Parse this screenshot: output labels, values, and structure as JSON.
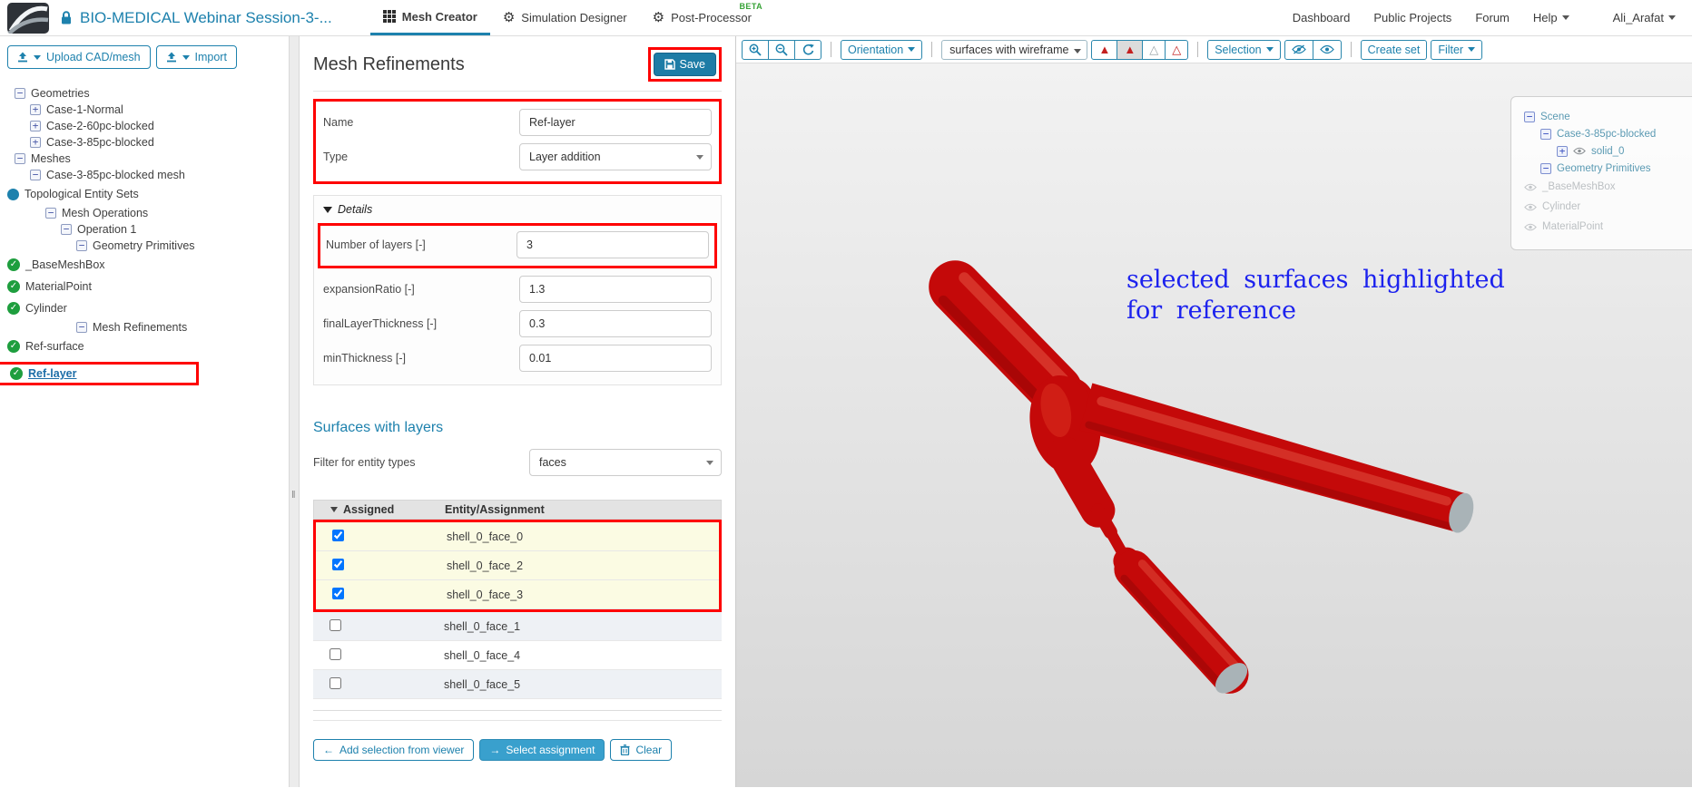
{
  "colors": {
    "accent": "#1d81ad",
    "annotation_box": "#fe0000",
    "annotation_text": "#1c22ee",
    "model_red": "#c40909",
    "model_cap_gray": "#a9b3b7",
    "beta_green": "#37a337",
    "row_selected_yellow": "#fbfbe3"
  },
  "icons": {
    "collapse": "−",
    "expand": "+",
    "check": "✓",
    "left_arrow": "←",
    "right_arrow": "→",
    "grip": "‖"
  },
  "navbar": {
    "project_title": "BIO-MEDICAL Webinar Session-3-...",
    "tabs": [
      {
        "label": "Mesh Creator",
        "active": true
      },
      {
        "label": "Simulation Designer",
        "active": false
      },
      {
        "label": "Post-Processor",
        "active": false,
        "badge": "BETA"
      }
    ],
    "links": [
      {
        "label": "Dashboard"
      },
      {
        "label": "Public Projects"
      },
      {
        "label": "Forum"
      },
      {
        "label": "Help"
      }
    ],
    "user": "Ali_Arafat"
  },
  "sidebar": {
    "upload_button": "Upload CAD/mesh",
    "import_button": "Import",
    "tree": [
      {
        "label": "Geometries",
        "depth": 0,
        "icon": "collapse"
      },
      {
        "label": "Case-1-Normal",
        "depth": 1,
        "icon": "expand"
      },
      {
        "label": "Case-2-60pc-blocked",
        "depth": 1,
        "icon": "expand"
      },
      {
        "label": "Case-3-85pc-blocked",
        "depth": 1,
        "icon": "expand"
      },
      {
        "label": "Meshes",
        "depth": 0,
        "icon": "collapse"
      },
      {
        "label": "Case-3-85pc-blocked mesh",
        "depth": 1,
        "icon": "collapse"
      },
      {
        "label": "Topological Entity Sets",
        "depth": 2,
        "icon": "dot"
      },
      {
        "label": "Mesh Operations",
        "depth": 2,
        "icon": "collapse"
      },
      {
        "label": "Operation 1",
        "depth": 3,
        "icon": "collapse"
      },
      {
        "label": "Geometry Primitives",
        "depth": 4,
        "icon": "collapse"
      },
      {
        "label": "_BaseMeshBox",
        "depth": 5,
        "icon": "check"
      },
      {
        "label": "MaterialPoint",
        "depth": 5,
        "icon": "check"
      },
      {
        "label": "Cylinder",
        "depth": 5,
        "icon": "check"
      },
      {
        "label": "Mesh Refinements",
        "depth": 4,
        "icon": "collapse"
      },
      {
        "label": "Ref-surface",
        "depth": 5,
        "icon": "check"
      },
      {
        "label": "Ref-layer",
        "depth": 5,
        "icon": "check",
        "selected": true
      }
    ]
  },
  "panel": {
    "title": "Mesh Refinements",
    "save_label": "Save",
    "fields": {
      "name_label": "Name",
      "name_value": "Ref-layer",
      "type_label": "Type",
      "type_value": "Layer addition"
    },
    "details": {
      "header": "Details",
      "rows": [
        {
          "label": "Number of layers [-]",
          "value": "3",
          "highlighted": true
        },
        {
          "label": "expansionRatio [-]",
          "value": "1.3",
          "highlighted": false
        },
        {
          "label": "finalLayerThickness [-]",
          "value": "0.3",
          "highlighted": false
        },
        {
          "label": "minThickness [-]",
          "value": "0.01",
          "highlighted": false
        }
      ]
    },
    "surfaces": {
      "heading": "Surfaces with layers",
      "filter_label": "Filter for entity types",
      "filter_value": "faces",
      "table_headers": {
        "assigned": "Assigned",
        "entity": "Entity/Assignment"
      },
      "rows": [
        {
          "entity": "shell_0_face_0",
          "checked": true,
          "highlighted": true
        },
        {
          "entity": "shell_0_face_2",
          "checked": true,
          "highlighted": true
        },
        {
          "entity": "shell_0_face_3",
          "checked": true,
          "highlighted": true
        },
        {
          "entity": "shell_0_face_1",
          "checked": false,
          "highlighted": false
        },
        {
          "entity": "shell_0_face_4",
          "checked": false,
          "highlighted": false
        },
        {
          "entity": "shell_0_face_5",
          "checked": false,
          "highlighted": false
        }
      ],
      "actions": {
        "add_selection": "Add selection from viewer",
        "select_assignment": "Select assignment",
        "clear": "Clear"
      }
    }
  },
  "viewer": {
    "toolbar": {
      "orientation": "Orientation",
      "render_mode": "surfaces with wireframe",
      "selection": "Selection",
      "create_set": "Create set",
      "filter": "Filter"
    },
    "scene_tree": [
      {
        "label": "Scene",
        "depth": 0,
        "icon": "collapse",
        "eye": false,
        "muted": false
      },
      {
        "label": "Case-3-85pc-blocked",
        "depth": 1,
        "icon": "collapse",
        "eye": false,
        "muted": false
      },
      {
        "label": "solid_0",
        "depth": 2,
        "icon": "expand",
        "eye": true,
        "muted": false
      },
      {
        "label": "Geometry Primitives",
        "depth": 1,
        "icon": "collapse",
        "eye": false,
        "muted": false
      },
      {
        "label": "_BaseMeshBox",
        "depth": 2,
        "icon": "none",
        "eye": true,
        "muted": true
      },
      {
        "label": "Cylinder",
        "depth": 2,
        "icon": "none",
        "eye": true,
        "muted": true
      },
      {
        "label": "MaterialPoint",
        "depth": 2,
        "icon": "none",
        "eye": true,
        "muted": true
      }
    ],
    "annotation_lines": [
      "selected surfaces highlighted",
      "for reference"
    ]
  }
}
